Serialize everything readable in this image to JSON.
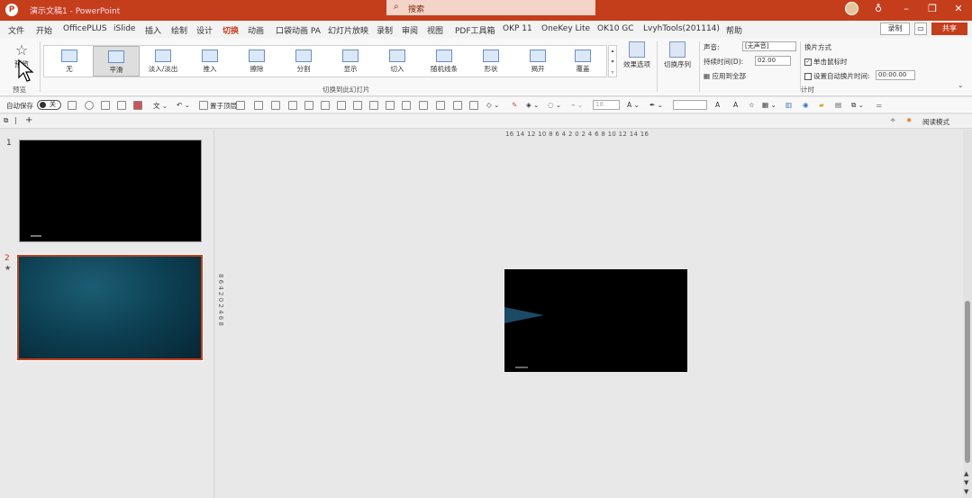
{
  "titlebar": {
    "logo": "P",
    "doc_title": "演示文稿1 - PowerPoint",
    "search_placeholder": "搜索",
    "search_icon": "search-icon"
  },
  "tabs": [
    "文件",
    "开始",
    "OfficePLUS",
    "iSlide",
    "插入",
    "绘制",
    "设计",
    "切换",
    "动画",
    "口袋动画 PA",
    "幻灯片放映",
    "录制",
    "审阅",
    "视图",
    "PDF工具箱",
    "OKP 11",
    "OneKey Lite",
    "OK10 GC",
    "LvyhTools(201114)",
    "帮助"
  ],
  "active_tab": "切换",
  "actions": {
    "record": "录制",
    "share": "共享"
  },
  "ribbon": {
    "preview_label": "预览",
    "preview_group": "预览",
    "gallery_group": "切换到此幻灯片",
    "effects": [
      "无",
      "平滑",
      "淡入/淡出",
      "推入",
      "擦除",
      "分割",
      "显示",
      "切入",
      "随机线条",
      "形状",
      "揭开",
      "覆盖"
    ],
    "active_effect": "平滑",
    "effect_options": "效果选项",
    "transition_sequence": "切换序列",
    "sound_label": "声音:",
    "sound_value": "[无声音]",
    "duration_label": "持续时间(D):",
    "duration_value": "02.00",
    "apply_all": "应用到全部",
    "advance_label": "换片方式",
    "on_click": "单击鼠标时",
    "after_label": "设置自动换片时间:",
    "after_value": "00:00.00",
    "timing_group": "计时"
  },
  "qtoolbar": {
    "autosave_label": "自动保存",
    "autosave_state": "关",
    "bring_forward": "置于顶层",
    "font_size_value": "18"
  },
  "subbar": {
    "reading_mode": "阅读模式"
  },
  "slides": [
    {
      "number": "1",
      "theme": "black"
    },
    {
      "number": "2",
      "theme": "teal",
      "selected": true
    }
  ],
  "rulers": {
    "horizontal": "16 14 12 10 8 6 4 2 0 2 4 6 8 10 12 14 16",
    "vertical": "8 6 4 2 0 2 4 6 8"
  }
}
